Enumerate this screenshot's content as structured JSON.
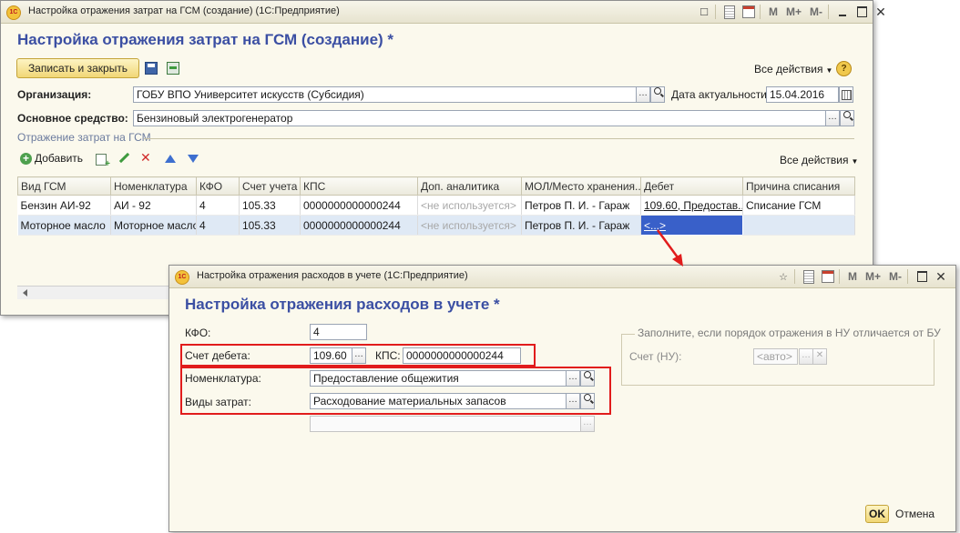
{
  "app_logo": "1С",
  "window_main": {
    "title": "Настройка отражения затрат на ГСМ (создание)  (1С:Предприятие)",
    "heading": "Настройка отражения затрат на ГСМ (создание) *",
    "toolbar_icons": {
      "m": "M",
      "mplus": "M+",
      "mminus": "M-"
    },
    "save_close_label": "Записать и закрыть",
    "all_actions_label": "Все действия",
    "help_label": "?",
    "organization_label": "Организация:",
    "organization_value": "ГОБУ ВПО Университет искусств (Субсидия)",
    "date_label": "Дата актуальности:",
    "date_value": "15.04.2016",
    "asset_label": "Основное средство:",
    "asset_value": "Бензиновый электрогенератор",
    "section_title": "Отражение затрат на ГСМ",
    "add_label": "Добавить",
    "section_all_actions": "Все действия",
    "columns": [
      "Вид ГСМ",
      "Номенклатура",
      "КФО",
      "Счет учета",
      "КПС",
      "Доп. аналитика",
      "МОЛ/Место хранения...",
      "Дебет",
      "Причина списания"
    ],
    "rows": [
      [
        "Бензин АИ-92",
        "АИ - 92",
        "4",
        "105.33",
        "0000000000000244",
        "<не используется>",
        "Петров П. И. - Гараж",
        "109.60, Предостав...",
        "Списание ГСМ"
      ],
      [
        "Моторное масло",
        "Моторное масло",
        "4",
        "105.33",
        "0000000000000244",
        "<не используется>",
        "Петров П. И. - Гараж",
        "<...>",
        ""
      ]
    ]
  },
  "window_dialog": {
    "title": "Настройка отражения расходов в учете  (1С:Предприятие)",
    "heading": "Настройка отражения расходов в учете *",
    "toolbar_icons": {
      "m": "M",
      "mplus": "M+",
      "mminus": "M-"
    },
    "kfo_label": "КФО:",
    "kfo_value": "4",
    "debit_account_label": "Счет дебета:",
    "debit_account_value": "109.60",
    "kps_label": "КПС:",
    "kps_value": "0000000000000244",
    "nomenclature_label": "Номенклатура:",
    "nomenclature_value": "Предоставление общежития",
    "cost_type_label": "Виды затрат:",
    "cost_type_value": "Расходование материальных запасов",
    "extra_value": "",
    "nu_group_title": "Заполните, если порядок отражения в НУ отличается от БУ",
    "nu_account_label": "Счет (НУ):",
    "nu_account_placeholder": "<авто>",
    "ok_label": "OK",
    "cancel_label": "Отмена"
  },
  "colors": {
    "heading": "#3b4fa3",
    "highlight": "#e11c1c",
    "selection": "#3960c9"
  }
}
